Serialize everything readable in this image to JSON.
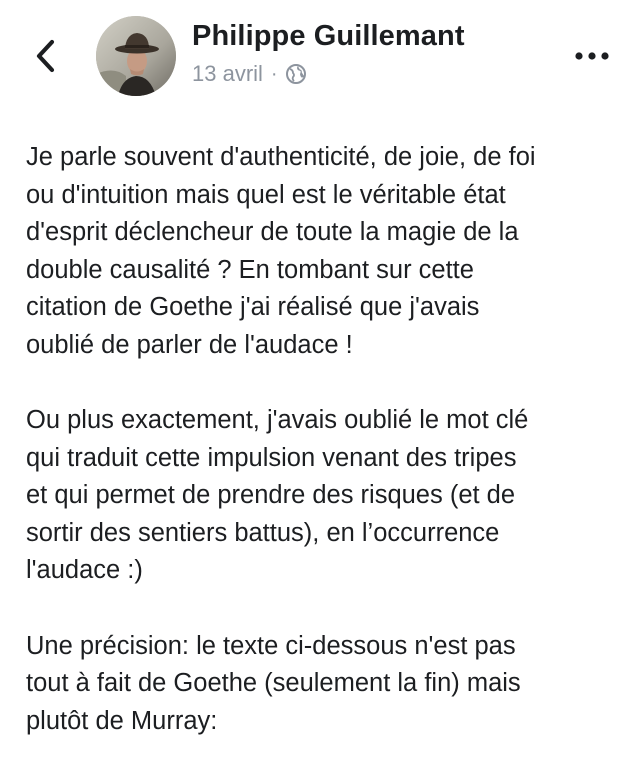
{
  "post": {
    "author": "Philippe Guillemant",
    "date": "13 avril",
    "separator": "·",
    "paragraphs": [
      "Je parle souvent d'authenticité, de joie, de foi\nou d'intuition mais quel est le véritable état\nd'esprit déclencheur de toute la magie de la\ndouble causalité ? En tombant sur cette\ncitation de Goethe j'ai réalisé que j'avais\noublié de parler de l'audace !",
      "Ou plus exactement, j'avais oublié le mot clé\nqui traduit cette impulsion venant des tripes\net qui permet de prendre des risques (et de\nsortir des sentiers battus), en l’occurrence\nl'audace :)",
      "Une précision: le texte ci-dessous n'est pas\ntout à fait de Goethe (seulement la fin) mais\nplutôt de Murray:"
    ]
  },
  "icons": {
    "back": "chevron-left-icon",
    "audience": "globe-icon",
    "more": "more-horizontal-icon"
  },
  "colors": {
    "text": "#1c1e21",
    "meta": "#8d949e",
    "background": "#ffffff"
  }
}
